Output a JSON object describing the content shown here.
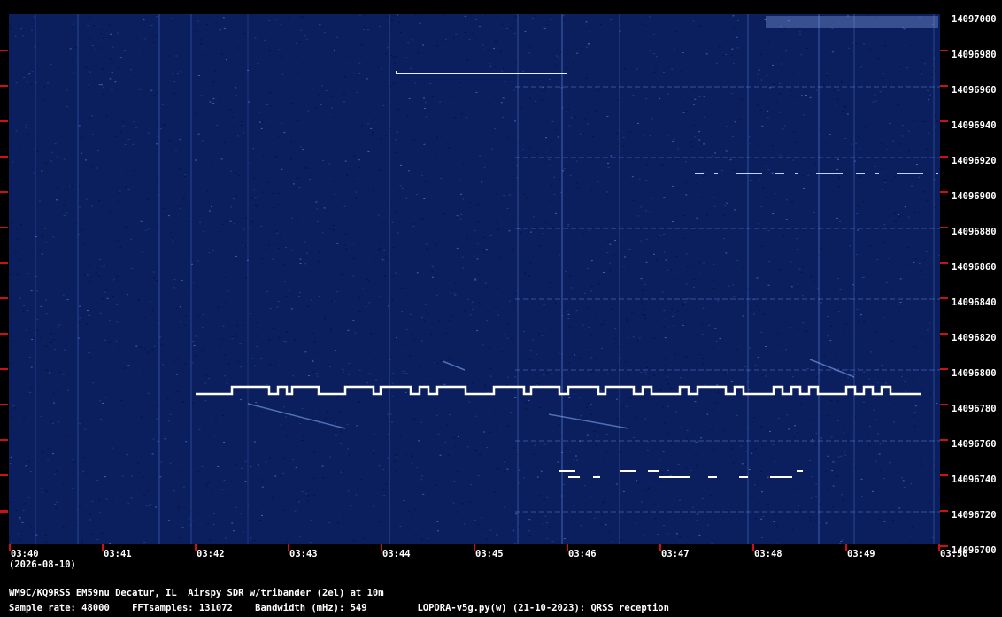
{
  "chart_data": {
    "type": "heatmap",
    "title": "",
    "xlabel": "",
    "ylabel": "",
    "x_ticks": [
      "03:40",
      "03:41",
      "03:42",
      "03:43",
      "03:44",
      "03:45",
      "03:46",
      "03:47",
      "03:48",
      "03:49",
      "03:50"
    ],
    "date_label": "(2026-08-10)",
    "y_ticks": [
      "14097000",
      "14096980",
      "14096960",
      "14096940",
      "14096920",
      "14096900",
      "14096880",
      "14096860",
      "14096840",
      "14096820",
      "14096800",
      "14096780",
      "14096760",
      "14096740",
      "14096720",
      "14096700"
    ],
    "ylim": [
      14096700,
      14097000
    ],
    "background_color": "#0b1e5e",
    "signal_color": "#ffffff",
    "tick_color": "#d01010"
  },
  "info": {
    "station_line": "WM9C/KQ9RSS EM59nu Decatur, IL  Airspy SDR w/tribander (2el) at 10m",
    "params_line": "Sample rate: 48000    FFTsamples: 131072    Bandwidth (mHz): 549         LOPORA-v5g.py(w) (21-10-2023): QRSS reception"
  }
}
